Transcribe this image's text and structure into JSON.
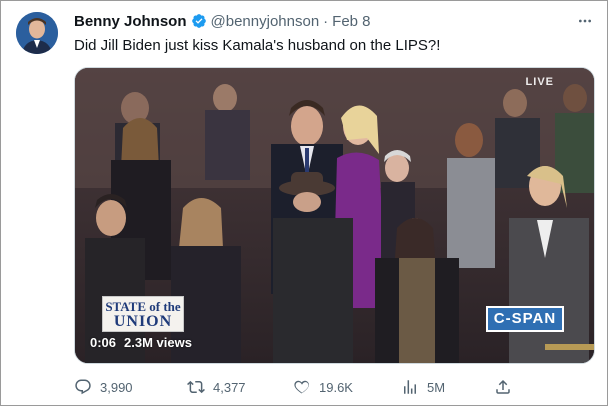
{
  "author": {
    "display_name": "Benny Johnson",
    "handle": "@bennyjohnson",
    "separator": "·",
    "date": "Feb 8",
    "verified": true
  },
  "more_icon": "more-horizontal-icon",
  "tweet_text": "Did Jill Biden just kiss Kamala's husband on the LIPS?!",
  "media": {
    "type": "video",
    "live_label": "LIVE",
    "overlay_logo_line1": "STATE of the",
    "overlay_logo_line2": "UNION",
    "network_logo": "C-SPAN",
    "time": "0:06",
    "views": "2.3M views"
  },
  "actions": {
    "replies": "3,990",
    "retweets": "4,377",
    "likes": "19.6K",
    "views": "5M"
  },
  "colors": {
    "verified": "#1d9bf0",
    "muted_text": "#536471",
    "text": "#0f1419"
  }
}
